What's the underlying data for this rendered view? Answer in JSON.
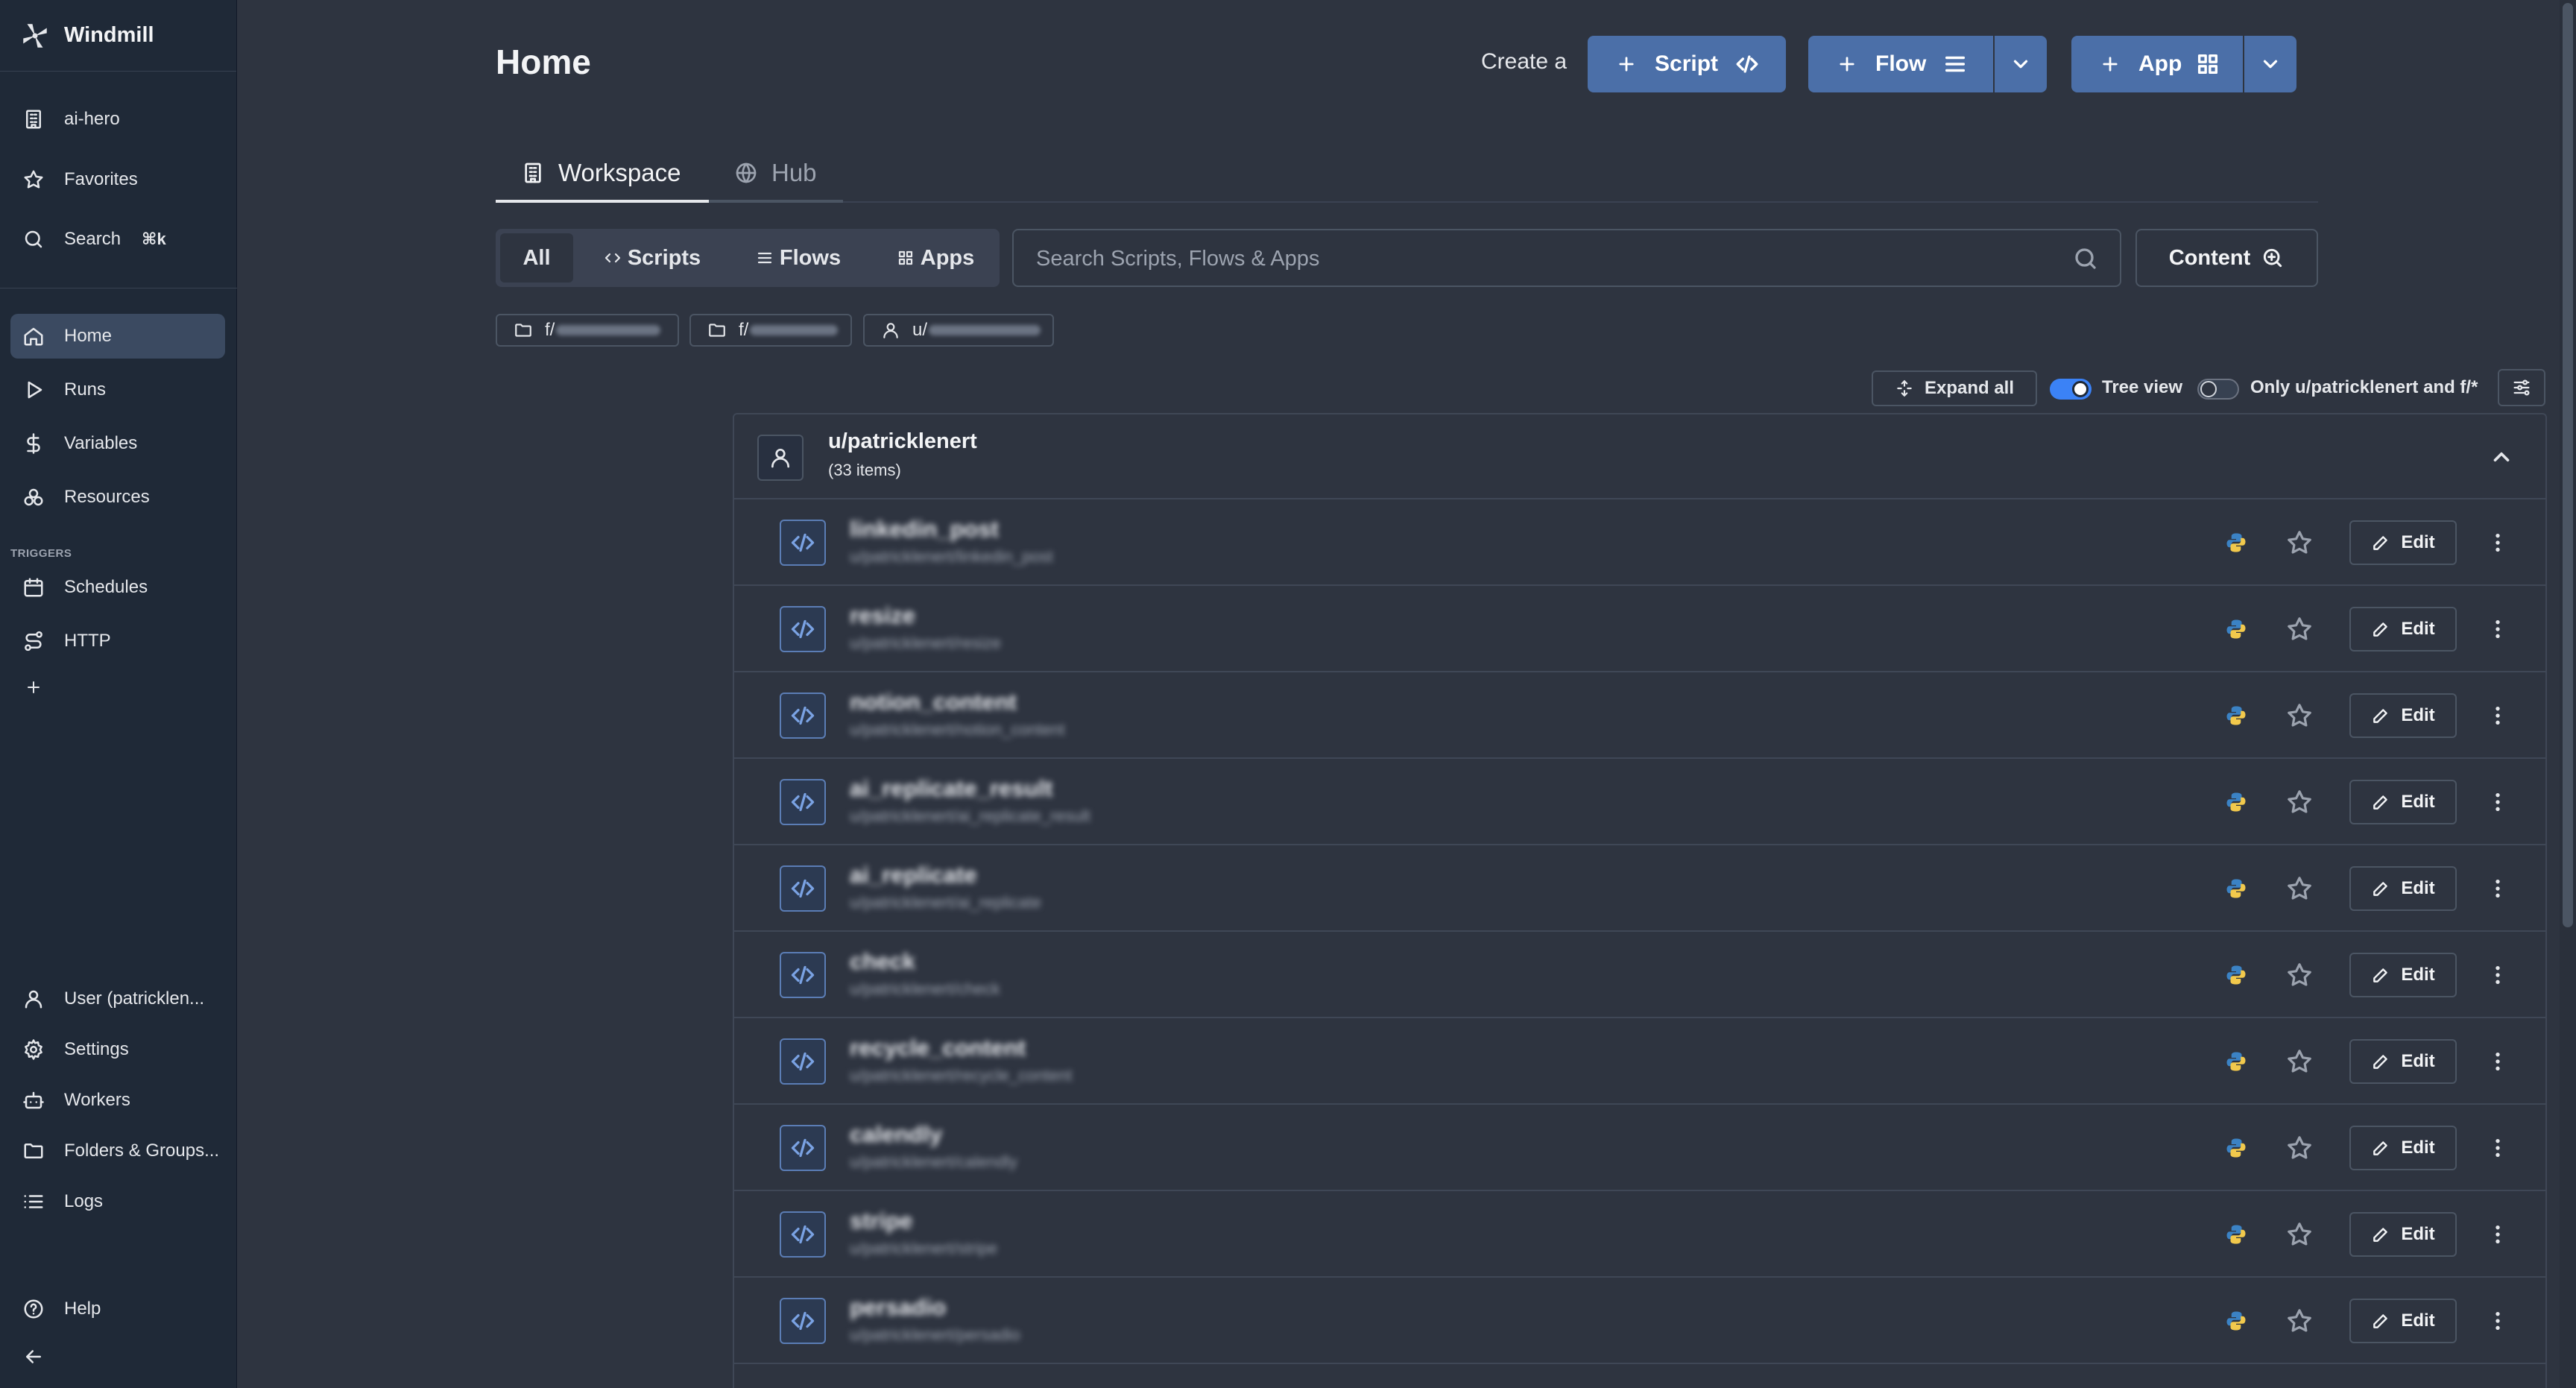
{
  "brand": {
    "name": "Windmill"
  },
  "sidebar": {
    "top": [
      {
        "label": "ai-hero",
        "icon": "building-icon"
      },
      {
        "label": "Favorites",
        "icon": "star-icon"
      },
      {
        "label": "Search",
        "icon": "search-icon",
        "shortcut": "⌘k"
      }
    ],
    "main": [
      {
        "label": "Home",
        "icon": "home-icon",
        "active": true
      },
      {
        "label": "Runs",
        "icon": "play-icon"
      },
      {
        "label": "Variables",
        "icon": "dollar-icon"
      },
      {
        "label": "Resources",
        "icon": "boxes-icon"
      }
    ],
    "triggers_caption": "TRIGGERS",
    "triggers": [
      {
        "label": "Schedules",
        "icon": "calendar-icon"
      },
      {
        "label": "HTTP",
        "icon": "route-icon"
      }
    ],
    "bottom": [
      {
        "label": "User (patricklen...",
        "icon": "user-icon"
      },
      {
        "label": "Settings",
        "icon": "gear-icon"
      },
      {
        "label": "Workers",
        "icon": "bot-icon"
      },
      {
        "label": "Folders & Groups...",
        "icon": "folder-icon"
      },
      {
        "label": "Logs",
        "icon": "list-icon"
      }
    ],
    "help": "Help"
  },
  "header": {
    "title": "Home",
    "create_label": "Create a",
    "script_btn": "Script",
    "flow_btn": "Flow",
    "app_btn": "App"
  },
  "tabs": [
    {
      "label": "Workspace",
      "active": true
    },
    {
      "label": "Hub",
      "active": false
    }
  ],
  "filters": {
    "types": [
      "All",
      "Scripts",
      "Flows",
      "Apps"
    ],
    "active": "All",
    "search_placeholder": "Search Scripts, Flows & Apps",
    "content_btn": "Content",
    "chips": [
      "f/",
      "f/",
      "u/"
    ]
  },
  "view_options": {
    "expand_all": "Expand all",
    "tree_view_label": "Tree view",
    "tree_view_on": true,
    "only_mine_label": "Only u/patricklenert and f/*",
    "only_mine_on": false
  },
  "group": {
    "owner": "u/patricklenert",
    "count": "(33 items)",
    "items": [
      {
        "name": "linkedin_post",
        "path": "u/patricklenert/linkedin_post"
      },
      {
        "name": "resize",
        "path": "u/patricklenert/resize"
      },
      {
        "name": "notion_content",
        "path": "u/patricklenert/notion_content"
      },
      {
        "name": "ai_replicate_result",
        "path": "u/patricklenert/ai_replicate_result"
      },
      {
        "name": "ai_replicate",
        "path": "u/patricklenert/ai_replicate"
      },
      {
        "name": "check",
        "path": "u/patricklenert/check"
      },
      {
        "name": "recycle_content",
        "path": "u/patricklenert/recycle_content"
      },
      {
        "name": "calendly",
        "path": "u/patricklenert/calendly"
      },
      {
        "name": "stripe",
        "path": "u/patricklenert/stripe"
      },
      {
        "name": "persadio",
        "path": "u/patricklenert/persadio"
      }
    ],
    "edit_label": "Edit"
  },
  "colors": {
    "accent": "#4b6fa8",
    "background": "#2e3440",
    "sidebar": "#1f2937",
    "toggle_on": "#3b82f6"
  }
}
